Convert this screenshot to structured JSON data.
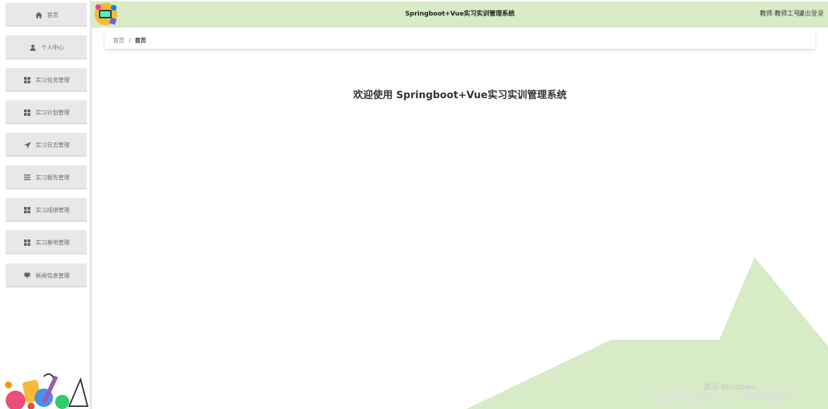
{
  "app": {
    "title": "Springboot+Vue实习实训管理系统",
    "user_label": "教师 教师工号8",
    "logout_label": "退出登录"
  },
  "sidebar": {
    "items": [
      {
        "label": "首页",
        "icon": "home-icon"
      },
      {
        "label": "个人中心",
        "icon": "user-icon"
      },
      {
        "label": "实习任务管理",
        "icon": "grid-icon"
      },
      {
        "label": "实习计划管理",
        "icon": "grid-icon"
      },
      {
        "label": "实习日志管理",
        "icon": "send-icon"
      },
      {
        "label": "实习报告管理",
        "icon": "list-icon"
      },
      {
        "label": "实习成绩管理",
        "icon": "grid-icon"
      },
      {
        "label": "实习基地管理",
        "icon": "grid-icon"
      },
      {
        "label": "新闻信息管理",
        "icon": "chat-icon"
      }
    ]
  },
  "breadcrumb": {
    "items": [
      "首页",
      "首页"
    ],
    "separator": "/"
  },
  "main": {
    "welcome": "欢迎使用 Springboot+Vue实习实训管理系统"
  },
  "watermarks": {
    "windows": "激活 Windows",
    "csdn": "CSDN @花儿~程序设计"
  },
  "colors": {
    "header_bg": "#d6ebc6",
    "shape_green": "#d6ebc6",
    "menu_bg": "#e8e8e8"
  }
}
